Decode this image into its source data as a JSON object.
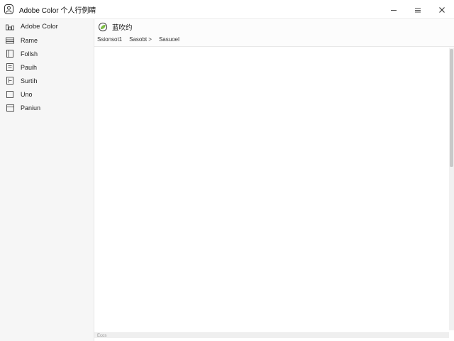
{
  "window": {
    "title": "Adobe Color 个人行例睛"
  },
  "sidebar": {
    "items": [
      {
        "label": "Adobe Color",
        "icon": "grid-icon"
      },
      {
        "label": "Rame",
        "icon": "card-icon"
      },
      {
        "label": "Follsh",
        "icon": "document-icon"
      },
      {
        "label": "Pauih",
        "icon": "page-icon"
      },
      {
        "label": "Surtih",
        "icon": "image-icon"
      },
      {
        "label": "Uno",
        "icon": "square-icon"
      },
      {
        "label": "Paniun",
        "icon": "panel-icon"
      }
    ]
  },
  "main": {
    "title": "蓝吹约",
    "title_icon": "leaf-circle-icon",
    "breadcrumb": [
      "Ssionsot1",
      "Sasobt >",
      "Sasuoel"
    ],
    "status_text": "Ecos"
  }
}
